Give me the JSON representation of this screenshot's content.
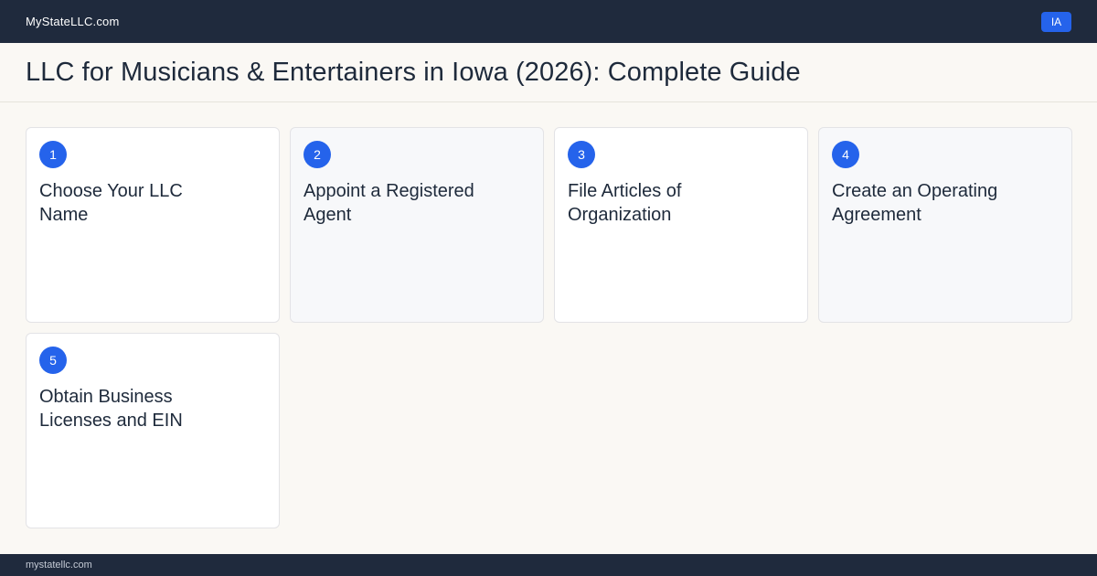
{
  "header": {
    "brand": "MyStateLLC.com",
    "state_badge": "IA"
  },
  "page": {
    "title": "LLC for Musicians & Entertainers  in Iowa (2026): Complete Guide"
  },
  "steps": [
    {
      "number": "1",
      "title": "Choose Your LLC Name"
    },
    {
      "number": "2",
      "title": "Appoint a Registered Agent"
    },
    {
      "number": "3",
      "title": "File Articles of Organization"
    },
    {
      "number": "4",
      "title": "Create an Operating Agreement"
    },
    {
      "number": "5",
      "title": "Obtain Business Licenses and EIN"
    }
  ],
  "footer": {
    "domain": "mystatellc.com"
  },
  "colors": {
    "nav_bg": "#1f2a3d",
    "accent": "#2563eb",
    "page_bg": "#faf8f4"
  }
}
